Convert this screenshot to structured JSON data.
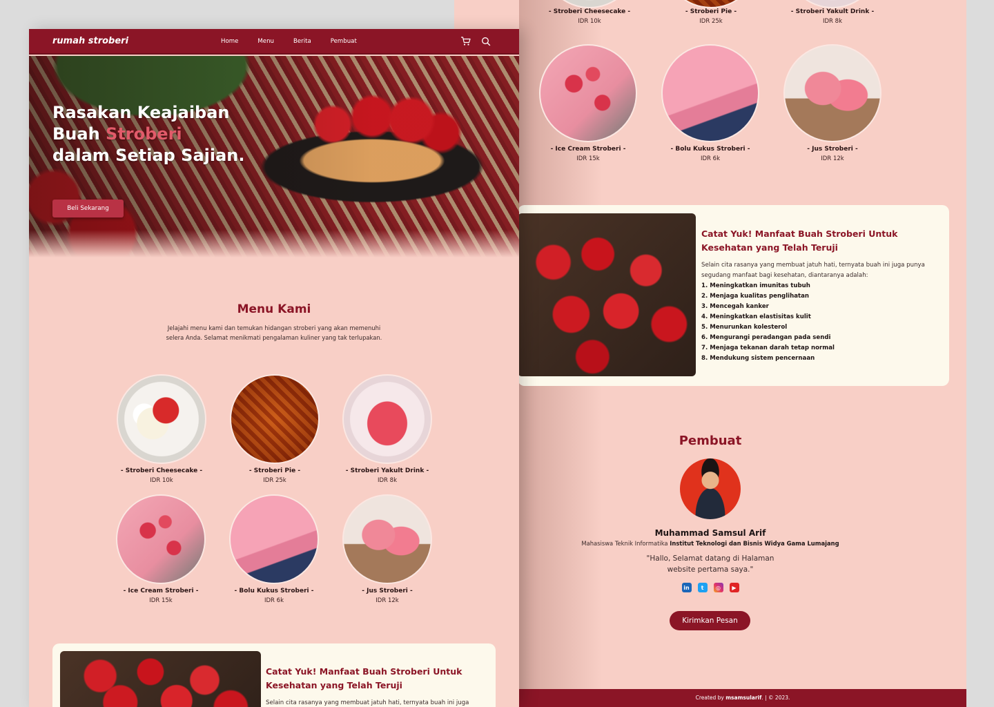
{
  "brand": {
    "logo": "rumah stroberi",
    "primary": "#8b1526",
    "background": "#f8cfc6",
    "card": "#fdf9ec"
  },
  "nav": {
    "links": [
      "Home",
      "Menu",
      "Berita",
      "Pembuat"
    ],
    "icons": [
      "cart-icon",
      "search-icon"
    ]
  },
  "hero": {
    "line1": "Rasakan Keajaiban",
    "line2_prefix": "Buah",
    "line2_accent": "Stroberi",
    "line3": "dalam Setiap Sajian.",
    "cta": "Beli Sekarang"
  },
  "menu": {
    "title": "Menu Kami",
    "subtitle": "Jelajahi menu kami dan temukan hidangan stroberi yang akan memenuhi selera Anda. Selamat menikmati pengalaman kuliner yang tak terlupakan.",
    "items": [
      {
        "name": "- Stroberi Cheesecake -",
        "price": "IDR 10k"
      },
      {
        "name": "- Stroberi Pie -",
        "price": "IDR 25k"
      },
      {
        "name": "- Stroberi Yakult Drink -",
        "price": "IDR 8k"
      },
      {
        "name": "- Ice Cream Stroberi -",
        "price": "IDR 15k"
      },
      {
        "name": "- Bolu Kukus Stroberi -",
        "price": "IDR 6k"
      },
      {
        "name": "- Jus Stroberi -",
        "price": "IDR 12k"
      }
    ]
  },
  "article": {
    "title": "Catat Yuk! Manfaat Buah Stroberi Untuk Kesehatan yang Telah Teruji",
    "intro": "Selain cita rasanya yang membuat jatuh hati, ternyata buah ini juga punya segudang manfaat bagi kesehatan, diantaranya adalah:",
    "benefits": [
      "1. Meningkatkan imunitas tubuh",
      "2. Menjaga kualitas penglihatan",
      "3. Mencegah kanker",
      "4. Meningkatkan elastisitas kulit",
      "5. Menurunkan kolesterol",
      "6. Mengurangi peradangan pada sendi",
      "7. Menjaga tekanan darah tetap normal",
      "8. Mendukung sistem pencernaan"
    ]
  },
  "pembuat": {
    "title": "Pembuat",
    "name": "Muhammad Samsul Arif",
    "role_prefix": "Mahasiswa Teknik Informatika",
    "role_school": "Institut Teknologi dan Bisnis Widya Gama Lumajang",
    "quote": "\"Hallo, Selamat datang di Halaman website pertama saya.\"",
    "socials": [
      "linkedin-icon",
      "twitter-icon",
      "instagram-icon",
      "youtube-icon"
    ],
    "button": "Kirimkan Pesan"
  },
  "footer": {
    "prefix": "Created by",
    "author": "msamsularif",
    "suffix": ". | © 2023."
  }
}
